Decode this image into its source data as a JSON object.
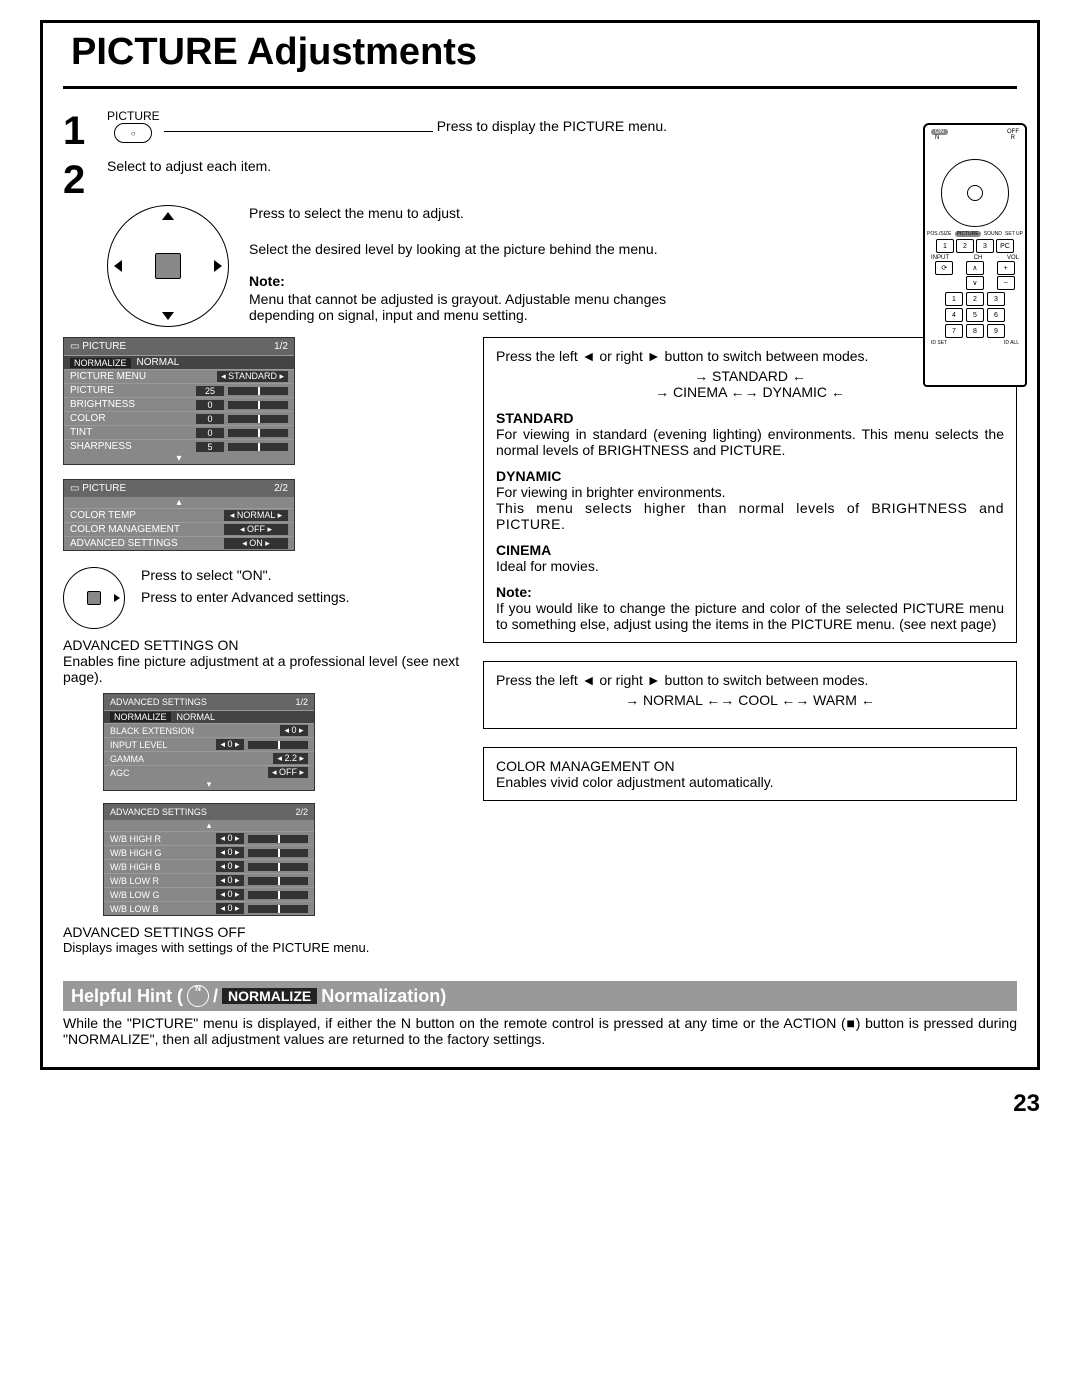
{
  "page": {
    "title": "PICTURE Adjustments",
    "pageNumber": "23"
  },
  "steps": {
    "one": {
      "num": "1",
      "btnLabel": "PICTURE",
      "action": "Press to display the PICTURE menu."
    },
    "two": {
      "num": "2",
      "intro": "Select to adjust each item.",
      "callout1": "Press to select the menu to adjust.",
      "callout2": "Select the desired level by looking at the picture behind the menu.",
      "noteLabel": "Note:",
      "noteBody": "Menu that cannot be adjusted is grayout. Adjustable menu changes depending on signal, input and menu setting."
    }
  },
  "osd1": {
    "header": "PICTURE",
    "page": "1/2",
    "normalize": "NORMALIZE",
    "normal": "NORMAL",
    "rows": {
      "pictureMenu": {
        "label": "PICTURE MENU",
        "value": "STANDARD"
      },
      "picture": {
        "label": "PICTURE",
        "value": "25"
      },
      "brightness": {
        "label": "BRIGHTNESS",
        "value": "0"
      },
      "color": {
        "label": "COLOR",
        "value": "0"
      },
      "tint": {
        "label": "TINT",
        "value": "0"
      },
      "sharpness": {
        "label": "SHARPNESS",
        "value": "5"
      }
    }
  },
  "osd2": {
    "header": "PICTURE",
    "page": "2/2",
    "rows": {
      "colorTemp": {
        "label": "COLOR TEMP",
        "value": "NORMAL"
      },
      "colorMgmt": {
        "label": "COLOR MANAGEMENT",
        "value": "OFF"
      },
      "advanced": {
        "label": "ADVANCED SETTINGS",
        "value": "ON"
      }
    }
  },
  "dpad2": {
    "callout1": "Press to select \"ON\".",
    "callout2": "Press to enter Advanced settings."
  },
  "adv": {
    "onHeading": "ADVANCED SETTINGS ON",
    "onBody": "Enables fine picture adjustment at a professional level (see next page).",
    "offHeading": "ADVANCED SETTINGS OFF",
    "offBody": "Displays images with settings of the PICTURE menu."
  },
  "osd3": {
    "header": "ADVANCED SETTINGS",
    "page": "1/2",
    "normalize": "NORMALIZE",
    "normal": "NORMAL",
    "rows": {
      "blackExt": {
        "label": "BLACK EXTENSION",
        "value": "0"
      },
      "inputLevel": {
        "label": "INPUT LEVEL",
        "value": "0"
      },
      "gamma": {
        "label": "GAMMA",
        "value": "2.2"
      },
      "agc": {
        "label": "AGC",
        "value": "OFF"
      }
    }
  },
  "osd4": {
    "header": "ADVANCED SETTINGS",
    "page": "2/2",
    "rows": {
      "whr": {
        "label": "W/B HIGH R",
        "value": "0"
      },
      "whg": {
        "label": "W/B HIGH G",
        "value": "0"
      },
      "whb": {
        "label": "W/B HIGH B",
        "value": "0"
      },
      "wlr": {
        "label": "W/B LOW R",
        "value": "0"
      },
      "wlg": {
        "label": "W/B LOW G",
        "value": "0"
      },
      "wlb": {
        "label": "W/B LOW B",
        "value": "0"
      }
    }
  },
  "right": {
    "modeSwitch": "Press the left ◄ or right ► button to switch between modes.",
    "diag1": {
      "a": "STANDARD",
      "b": "CINEMA",
      "c": "DYNAMIC"
    },
    "standard": {
      "heading": "STANDARD",
      "body": "For viewing in standard (evening lighting) environments. This menu selects the normal levels of BRIGHTNESS and PICTURE."
    },
    "dynamic": {
      "heading": "DYNAMIC",
      "body": "For viewing in brighter environments.",
      "body2": "This menu selects higher than normal levels of BRIGHTNESS and PICTURE."
    },
    "cinema": {
      "heading": "CINEMA",
      "body": "Ideal for movies."
    },
    "note": {
      "label": "Note:",
      "body": "If you would like to change the picture and color of the selected PICTURE menu to something else, adjust using the items in the PICTURE menu. (see next page)"
    },
    "tempSwitch": "Press the left ◄ or right ► button to switch between modes.",
    "diag2": {
      "a": "NORMAL",
      "b": "COOL",
      "c": "WARM"
    },
    "colorMgmt": {
      "heading": "COLOR MANAGEMENT ON",
      "body": "Enables vivid color adjustment automatically."
    }
  },
  "hint": {
    "prefix": "Helpful Hint (",
    "n": "N",
    "slash": " / ",
    "normalize": "NORMALIZE",
    "suffix": " Normalization)",
    "body": "While the \"PICTURE\" menu is displayed, if either the N button on the remote control is pressed at any time or the ACTION (■) button is pressed during \"NORMALIZE\", then all adjustment values are returned to the factory settings."
  },
  "remote": {
    "on": "ON",
    "off": "OFF",
    "n": "N",
    "r": "R",
    "row1": [
      "POS./SIZE",
      "PICTURE",
      "SOUND",
      "SET UP"
    ],
    "input": "INPUT",
    "ch": "CH",
    "vol": "VOL",
    "pcRow": [
      "1",
      "2",
      "3",
      "PC"
    ],
    "numpad": [
      "1",
      "2",
      "3",
      "4",
      "5",
      "6",
      "7",
      "8",
      "9"
    ],
    "idset": "ID SET",
    "idall": "ID ALL"
  }
}
